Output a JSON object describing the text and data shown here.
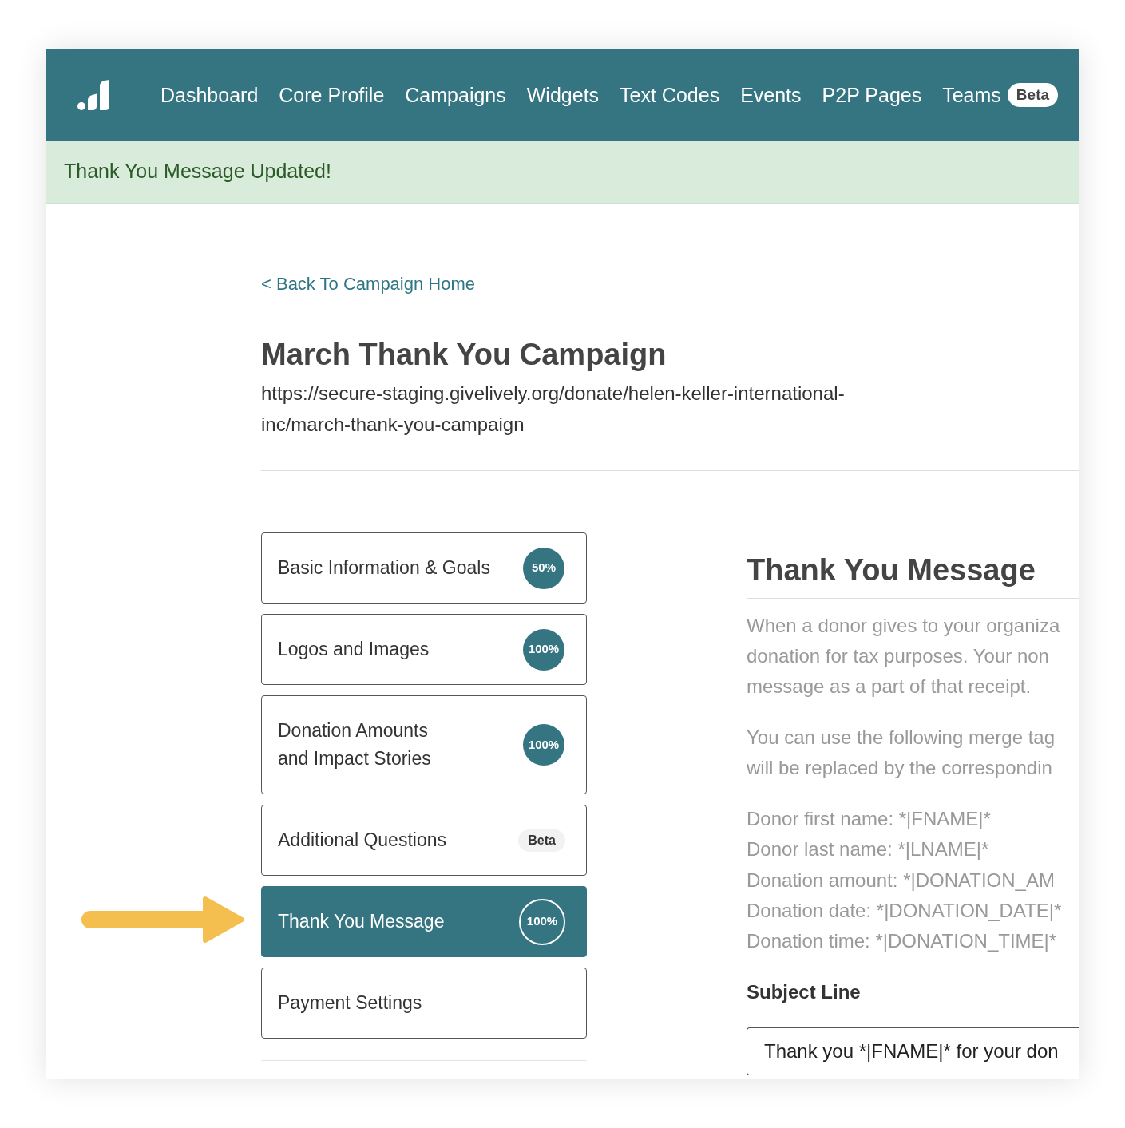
{
  "nav": {
    "items": [
      {
        "label": "Dashboard"
      },
      {
        "label": "Core Profile"
      },
      {
        "label": "Campaigns"
      },
      {
        "label": "Widgets"
      },
      {
        "label": "Text Codes"
      },
      {
        "label": "Events"
      },
      {
        "label": "P2P Pages"
      },
      {
        "label": "Teams",
        "tag": "Beta"
      }
    ]
  },
  "alert": {
    "message": "Thank You Message Updated!"
  },
  "back_link": "< Back To Campaign Home",
  "campaign": {
    "title": "March Thank You Campaign",
    "url": "https://secure-staging.givelively.org/donate/helen-keller-international-inc/march-thank-you-campaign"
  },
  "sections": [
    {
      "label": "Basic Information & Goals",
      "badge": {
        "kind": "progress",
        "text": "50%"
      },
      "selected": false
    },
    {
      "label": "Logos and Images",
      "badge": {
        "kind": "progress",
        "text": "100%"
      },
      "selected": false
    },
    {
      "label": "Donation Amounts\nand Impact Stories",
      "badge": {
        "kind": "progress",
        "text": "100%"
      },
      "selected": false
    },
    {
      "label": "Additional Questions",
      "badge": {
        "kind": "tag",
        "text": "Beta"
      },
      "selected": false
    },
    {
      "label": "Thank You Message",
      "badge": {
        "kind": "progress",
        "text": "100%"
      },
      "selected": true
    },
    {
      "label": "Payment Settings",
      "selected": false
    }
  ],
  "panel": {
    "title": "Thank You Message",
    "paragraphs": [
      [
        "When a donor gives to your organiza",
        "donation for tax purposes. Your non",
        "message as a part of that receipt."
      ],
      [
        "You can use the following merge tag",
        "will be replaced by the correspondin"
      ]
    ],
    "merge_tags": [
      "Donor first name: *|FNAME|*",
      "Donor last name: *|LNAME|*",
      "Donation amount: *|DONATION_AM",
      "Donation date: *|DONATION_DATE|*",
      "Donation time: *|DONATION_TIME|*"
    ],
    "subject": {
      "label": "Subject Line",
      "value": "Thank you *|FNAME|* for your don"
    }
  }
}
